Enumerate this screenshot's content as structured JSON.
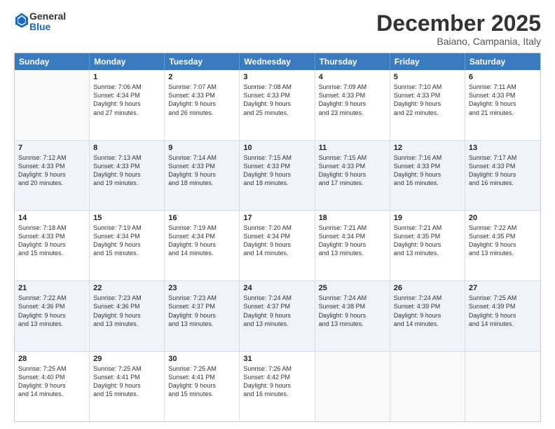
{
  "header": {
    "logo_general": "General",
    "logo_blue": "Blue",
    "month_title": "December 2025",
    "location": "Baiano, Campania, Italy"
  },
  "days_of_week": [
    "Sunday",
    "Monday",
    "Tuesday",
    "Wednesday",
    "Thursday",
    "Friday",
    "Saturday"
  ],
  "weeks": [
    [
      {
        "day": "",
        "info": ""
      },
      {
        "day": "1",
        "info": "Sunrise: 7:06 AM\nSunset: 4:34 PM\nDaylight: 9 hours\nand 27 minutes."
      },
      {
        "day": "2",
        "info": "Sunrise: 7:07 AM\nSunset: 4:33 PM\nDaylight: 9 hours\nand 26 minutes."
      },
      {
        "day": "3",
        "info": "Sunrise: 7:08 AM\nSunset: 4:33 PM\nDaylight: 9 hours\nand 25 minutes."
      },
      {
        "day": "4",
        "info": "Sunrise: 7:09 AM\nSunset: 4:33 PM\nDaylight: 9 hours\nand 23 minutes."
      },
      {
        "day": "5",
        "info": "Sunrise: 7:10 AM\nSunset: 4:33 PM\nDaylight: 9 hours\nand 22 minutes."
      },
      {
        "day": "6",
        "info": "Sunrise: 7:11 AM\nSunset: 4:33 PM\nDaylight: 9 hours\nand 21 minutes."
      }
    ],
    [
      {
        "day": "7",
        "info": "Sunrise: 7:12 AM\nSunset: 4:33 PM\nDaylight: 9 hours\nand 20 minutes."
      },
      {
        "day": "8",
        "info": "Sunrise: 7:13 AM\nSunset: 4:33 PM\nDaylight: 9 hours\nand 19 minutes."
      },
      {
        "day": "9",
        "info": "Sunrise: 7:14 AM\nSunset: 4:33 PM\nDaylight: 9 hours\nand 18 minutes."
      },
      {
        "day": "10",
        "info": "Sunrise: 7:15 AM\nSunset: 4:33 PM\nDaylight: 9 hours\nand 18 minutes."
      },
      {
        "day": "11",
        "info": "Sunrise: 7:15 AM\nSunset: 4:33 PM\nDaylight: 9 hours\nand 17 minutes."
      },
      {
        "day": "12",
        "info": "Sunrise: 7:16 AM\nSunset: 4:33 PM\nDaylight: 9 hours\nand 16 minutes."
      },
      {
        "day": "13",
        "info": "Sunrise: 7:17 AM\nSunset: 4:33 PM\nDaylight: 9 hours\nand 16 minutes."
      }
    ],
    [
      {
        "day": "14",
        "info": "Sunrise: 7:18 AM\nSunset: 4:33 PM\nDaylight: 9 hours\nand 15 minutes."
      },
      {
        "day": "15",
        "info": "Sunrise: 7:19 AM\nSunset: 4:34 PM\nDaylight: 9 hours\nand 15 minutes."
      },
      {
        "day": "16",
        "info": "Sunrise: 7:19 AM\nSunset: 4:34 PM\nDaylight: 9 hours\nand 14 minutes."
      },
      {
        "day": "17",
        "info": "Sunrise: 7:20 AM\nSunset: 4:34 PM\nDaylight: 9 hours\nand 14 minutes."
      },
      {
        "day": "18",
        "info": "Sunrise: 7:21 AM\nSunset: 4:34 PM\nDaylight: 9 hours\nand 13 minutes."
      },
      {
        "day": "19",
        "info": "Sunrise: 7:21 AM\nSunset: 4:35 PM\nDaylight: 9 hours\nand 13 minutes."
      },
      {
        "day": "20",
        "info": "Sunrise: 7:22 AM\nSunset: 4:35 PM\nDaylight: 9 hours\nand 13 minutes."
      }
    ],
    [
      {
        "day": "21",
        "info": "Sunrise: 7:22 AM\nSunset: 4:36 PM\nDaylight: 9 hours\nand 13 minutes."
      },
      {
        "day": "22",
        "info": "Sunrise: 7:23 AM\nSunset: 4:36 PM\nDaylight: 9 hours\nand 13 minutes."
      },
      {
        "day": "23",
        "info": "Sunrise: 7:23 AM\nSunset: 4:37 PM\nDaylight: 9 hours\nand 13 minutes."
      },
      {
        "day": "24",
        "info": "Sunrise: 7:24 AM\nSunset: 4:37 PM\nDaylight: 9 hours\nand 13 minutes."
      },
      {
        "day": "25",
        "info": "Sunrise: 7:24 AM\nSunset: 4:38 PM\nDaylight: 9 hours\nand 13 minutes."
      },
      {
        "day": "26",
        "info": "Sunrise: 7:24 AM\nSunset: 4:39 PM\nDaylight: 9 hours\nand 14 minutes."
      },
      {
        "day": "27",
        "info": "Sunrise: 7:25 AM\nSunset: 4:39 PM\nDaylight: 9 hours\nand 14 minutes."
      }
    ],
    [
      {
        "day": "28",
        "info": "Sunrise: 7:25 AM\nSunset: 4:40 PM\nDaylight: 9 hours\nand 14 minutes."
      },
      {
        "day": "29",
        "info": "Sunrise: 7:25 AM\nSunset: 4:41 PM\nDaylight: 9 hours\nand 15 minutes."
      },
      {
        "day": "30",
        "info": "Sunrise: 7:25 AM\nSunset: 4:41 PM\nDaylight: 9 hours\nand 15 minutes."
      },
      {
        "day": "31",
        "info": "Sunrise: 7:26 AM\nSunset: 4:42 PM\nDaylight: 9 hours\nand 16 minutes."
      },
      {
        "day": "",
        "info": ""
      },
      {
        "day": "",
        "info": ""
      },
      {
        "day": "",
        "info": ""
      }
    ]
  ]
}
